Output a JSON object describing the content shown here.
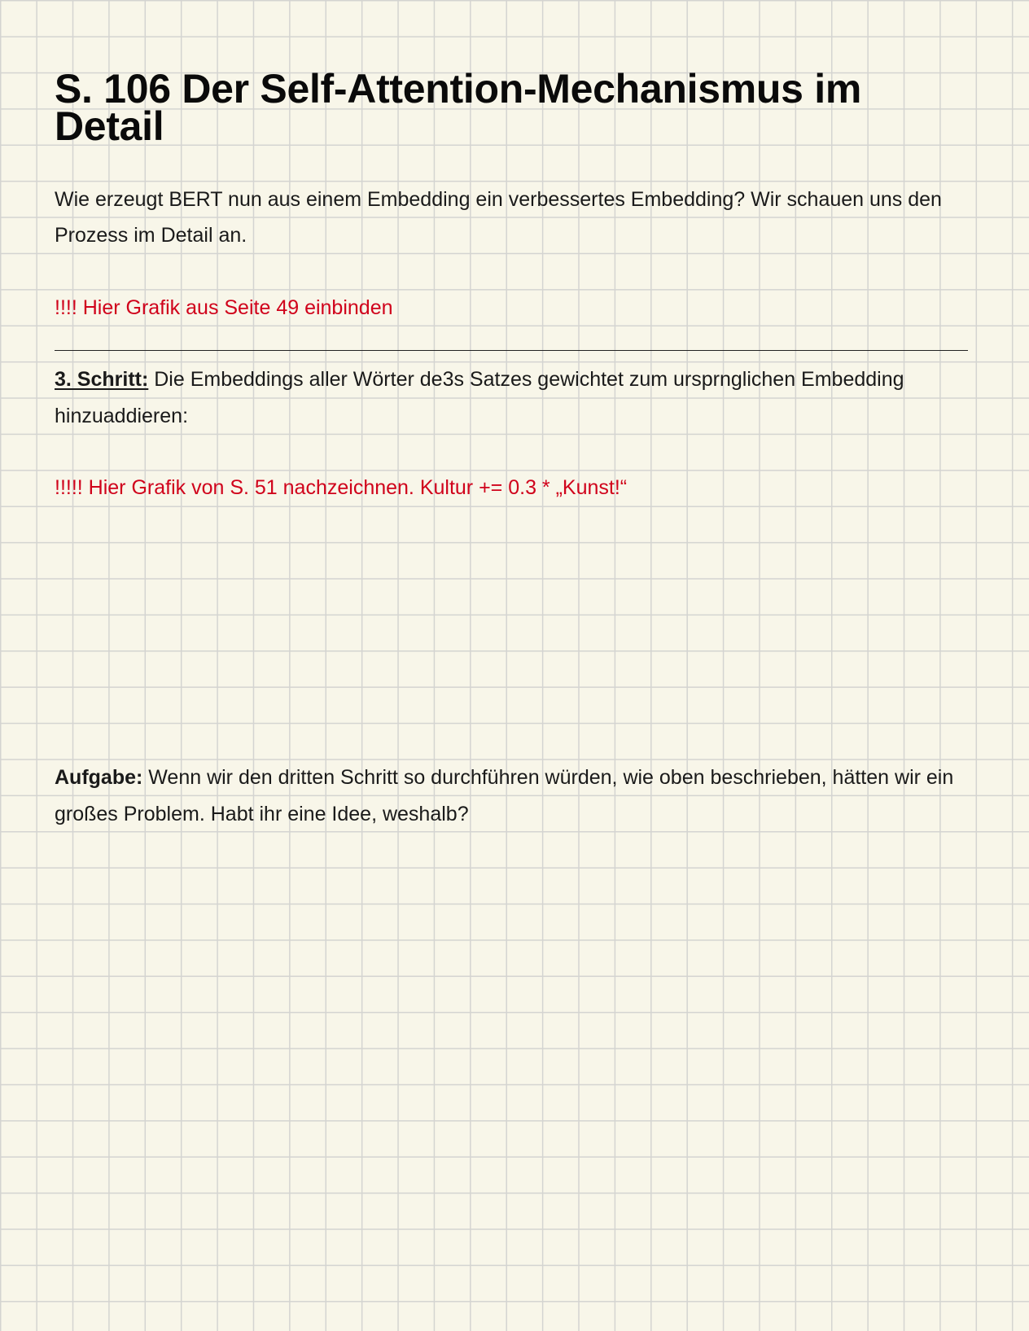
{
  "title": "S. 106 Der Self-Attention-Mechanismus im Detail",
  "intro": "Wie erzeugt BERT nun aus einem Embedding ein verbessertes Embedding? Wir schauen uns den Prozess im Detail an.",
  "note_1": "!!!! Hier Grafik aus Seite 49 einbinden",
  "step": {
    "label": "3. Schritt:",
    "text": " Die Embeddings aller Wörter de3s Satzes gewichtet zum ursprnglichen Embedding hinzuaddieren:"
  },
  "note_2": "!!!!! Hier Grafik von S. 51 nachzeichnen. Kultur += 0.3 * „Kunst!“",
  "task": {
    "label": "Aufgabe:",
    "text": " Wenn wir den dritten Schritt so durchführen würden, wie oben beschrieben, hätten wir ein großes Problem. Habt ihr eine Idee, weshalb?"
  },
  "colors": {
    "background": "#f8f6e9",
    "grid": "#d4d4d1",
    "note": "#d0021b",
    "text": "#111111"
  }
}
